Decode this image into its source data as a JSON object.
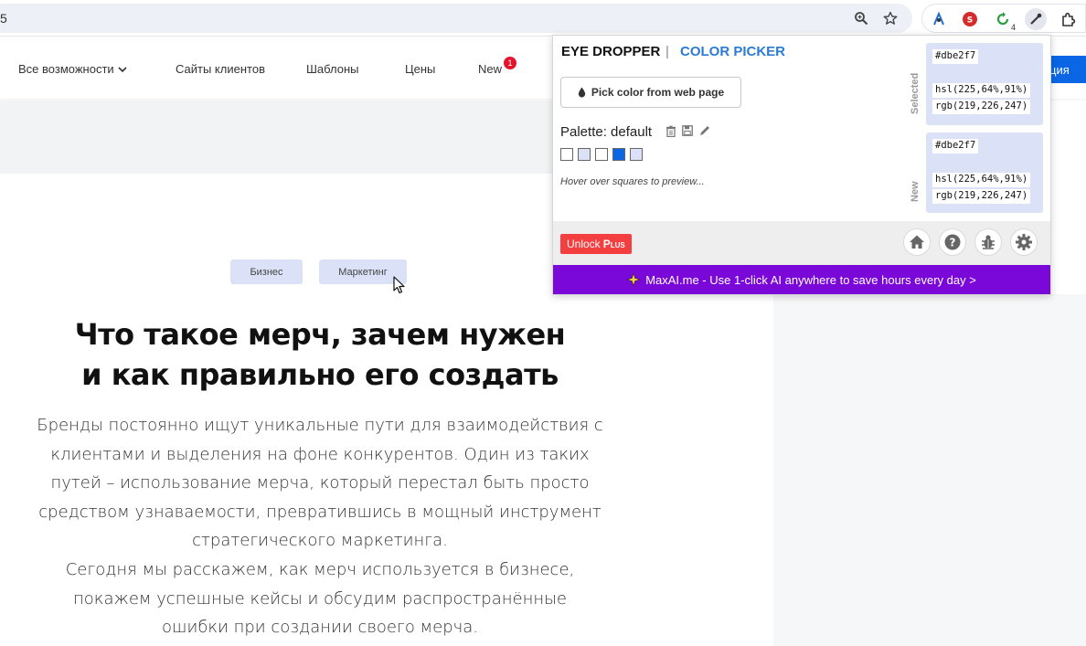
{
  "browser": {
    "url_fragment": "5",
    "extension_badge": "4"
  },
  "site": {
    "nav": [
      {
        "label": "Все возможности"
      },
      {
        "label": "Сайты клиентов"
      },
      {
        "label": "Шаблоны"
      },
      {
        "label": "Цены"
      },
      {
        "label": "New",
        "badge": "1"
      }
    ],
    "cta_label": "ция"
  },
  "article": {
    "tags": [
      "Бизнес",
      "Маркетинг"
    ],
    "headline_lines": [
      "Что такое мерч, зачем нужен",
      "и как правильно его создать"
    ],
    "paragraph_lines": [
      "Бренды постоянно ищут уникальные пути для взаимодействия с",
      "клиентами и выделения на фоне конкурентов. Один из таких",
      "путей – использование мерча, который перестал быть просто",
      "средством узнаваемости, превратившись в мощный инструмент",
      "стратегического маркетинга.",
      "Сегодня мы расскажем, как мерч используется в бизнесе,",
      "покажем успешные кейсы и обсудим распространённые",
      "ошибки при создании своего мерча."
    ]
  },
  "popup": {
    "tab_eye_dropper": "EYE DROPPER",
    "tab_separator": "|",
    "tab_color_picker": "COLOR PICKER",
    "pick_button_label": "Pick color from web page",
    "palette_label": "Palette: default",
    "swatches": [
      "#ffffff",
      "#dbe2f7",
      "#ffffff",
      "#0a66e4",
      "#dbe2f7"
    ],
    "hover_hint": "Hover over squares to preview...",
    "selected": {
      "label": "Selected",
      "hex": "#dbe2f7",
      "hsl": "hsl(225,64%,91%)",
      "rgb": "rgb(219,226,247)"
    },
    "new": {
      "label": "New",
      "hex": "#dbe2f7",
      "hsl": "hsl(225,64%,91%)",
      "rgb": "rgb(219,226,247)"
    },
    "unlock_label": "Unlock",
    "unlock_plus": "Plus",
    "promo_text": "MaxAI.me - Use 1-click AI anywhere to save hours every day >"
  },
  "colors": {
    "accent_blue": "#2b7bd4",
    "cta_blue": "#0a66e4",
    "unlock_red": "#f33f3f",
    "promo_purple": "#7a08d8",
    "tag_bg": "#dbe2f7"
  }
}
